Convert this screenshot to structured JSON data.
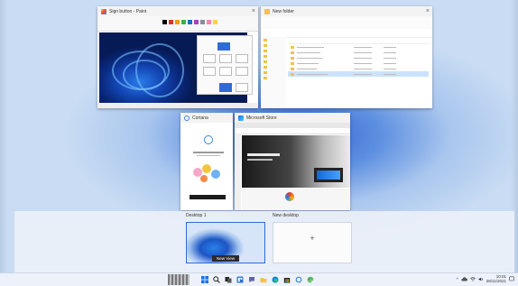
{
  "windows": {
    "paint": {
      "title": "Sign button - Paint",
      "icon": "paint-app-icon"
    },
    "explorer": {
      "title": "New folder",
      "files": [
        "",
        "",
        "",
        "",
        "",
        ""
      ],
      "selected_index": 5
    },
    "cortana": {
      "title": "Cortana",
      "sign_in_text": "Sign in to Cortana",
      "button_label": ""
    },
    "edge": {
      "title": "Microsoft Store"
    }
  },
  "desktops": [
    {
      "label": "Desktop 1",
      "badge": "New View"
    },
    {
      "label": "New desktop",
      "add_symbol": "+"
    }
  ],
  "taskbar": {
    "icons": [
      "start-icon",
      "search-icon",
      "task-view-icon",
      "widgets-icon",
      "chat-icon",
      "file-explorer-icon",
      "edge-icon",
      "store-icon",
      "cortana-icon",
      "paint-icon"
    ],
    "tray_chevron": "^",
    "time": "10:01",
    "date": "28/11/2021"
  },
  "colors": {
    "accent": "#2f6bd6",
    "wallpaper_blue": "#2b5fd0",
    "folder_yellow": "#f1c24b"
  }
}
